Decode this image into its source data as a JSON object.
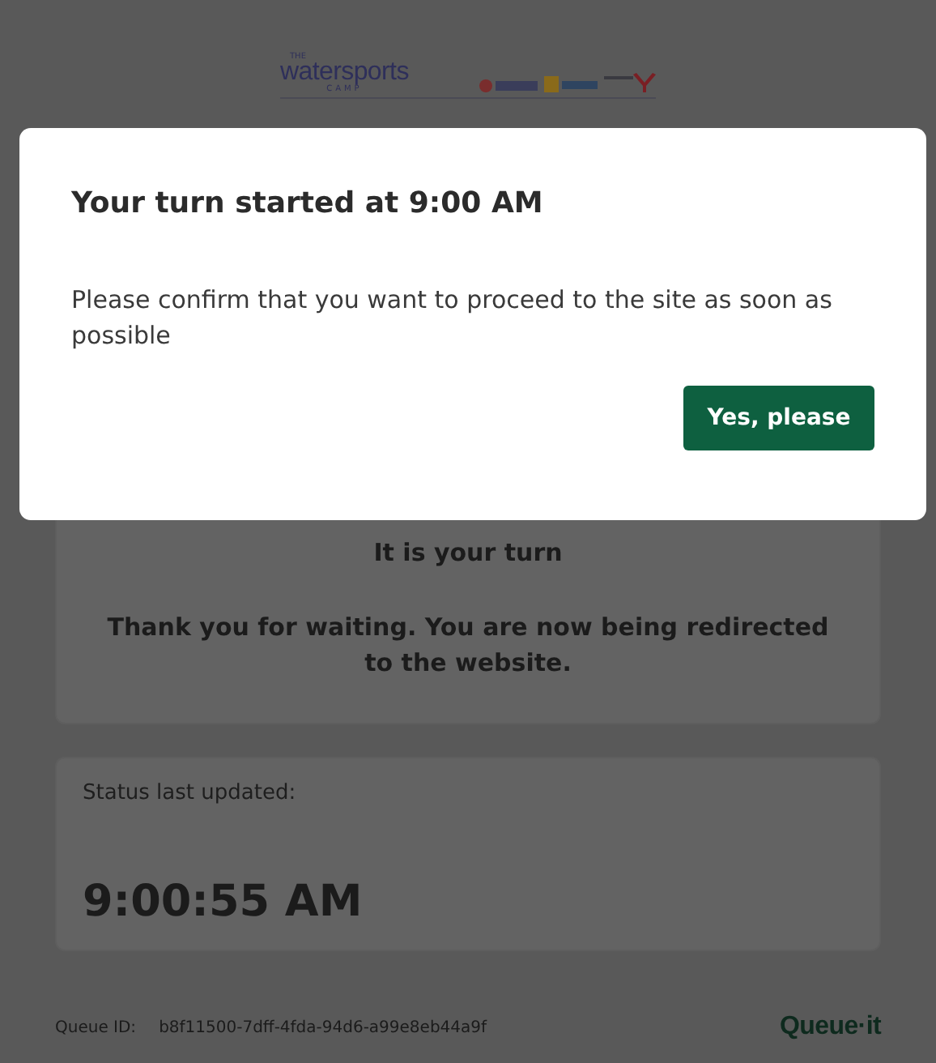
{
  "header": {
    "logo": {
      "small": "THE",
      "main": "watersports",
      "sub": "CAMP"
    }
  },
  "turn_card": {
    "title": "It is your turn",
    "message": "Thank you for waiting. You are now being redirected to the website."
  },
  "status_card": {
    "label": "Status last updated:",
    "time": "9:00:55 AM"
  },
  "footer": {
    "queue_id_label": "Queue ID:",
    "queue_id": "b8f11500-7dff-4fda-94d6-a99e8eb44a9f",
    "brand": "Queue·it"
  },
  "dialog": {
    "title": "Your turn started at 9:00 AM",
    "message": "Please confirm that you want to proceed to the site as soon as possible",
    "button": "Yes, please"
  }
}
